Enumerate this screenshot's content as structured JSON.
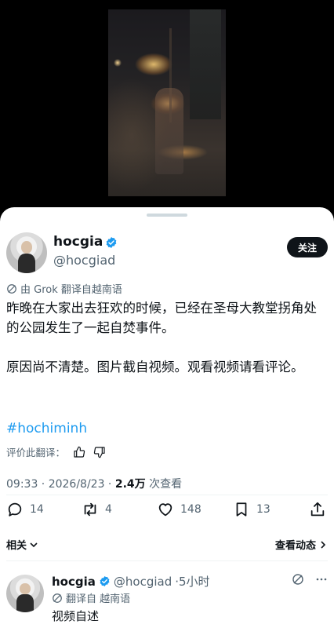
{
  "post": {
    "author_name": "hocgia",
    "author_handle": "@hocgiad",
    "follow_label": "关注",
    "translate_notice": "由 Grok 翻译自越南语",
    "paragraphs": [
      "昨晚在大家出去狂欢的时候，已经在圣母大教堂拐角处的公园发生了一起自焚事件。",
      "原因尚不清楚。图片截自视频。观看视频请看评论。"
    ],
    "hashtag": "#hochiminh",
    "rate_label": "评价此翻译：",
    "timestamp": "09:33 · 2026/8/23 · ",
    "views_count": "2.4万",
    "views_label": " 次查看"
  },
  "actions": {
    "replies": "14",
    "reposts": "4",
    "likes": "148",
    "bookmarks": "13"
  },
  "related": {
    "left_label": "相关",
    "right_label": "查看动态"
  },
  "reply": {
    "author_name": "hocgia",
    "author_handle": "@hocgiad",
    "time": "·5小时",
    "translate_notice": "翻译自 越南语",
    "text": "视频自述"
  },
  "colors": {
    "accent": "#1d9bf0",
    "text": "#0f1419",
    "muted": "#536471"
  },
  "icons": [
    "verified-badge-icon",
    "grok-icon",
    "thumbs-up-icon",
    "thumbs-down-icon",
    "reply-icon",
    "repost-icon",
    "like-icon",
    "bookmark-icon",
    "share-icon",
    "chevron-down-icon",
    "chevron-right-icon",
    "more-icon"
  ]
}
